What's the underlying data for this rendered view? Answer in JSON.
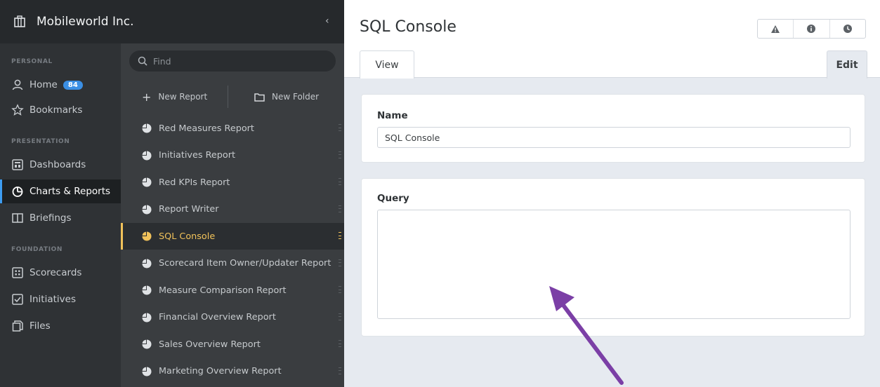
{
  "org": {
    "name": "Mobileworld Inc.",
    "collapse_glyph": "‹"
  },
  "nav": {
    "sections": [
      {
        "id": "personal",
        "label": "PERSONAL"
      },
      {
        "id": "presentation",
        "label": "PRESENTATION"
      },
      {
        "id": "foundation",
        "label": "FOUNDATION"
      }
    ],
    "items": [
      {
        "label": "Home",
        "icon": "user-icon",
        "badge": "84"
      },
      {
        "label": "Bookmarks",
        "icon": "star-icon"
      },
      {
        "label": "Dashboards",
        "icon": "dashboard-icon"
      },
      {
        "label": "Charts & Reports",
        "icon": "pie-chart-icon",
        "active": true
      },
      {
        "label": "Briefings",
        "icon": "book-icon"
      },
      {
        "label": "Scorecards",
        "icon": "scorecard-icon"
      },
      {
        "label": "Initiatives",
        "icon": "checkbox-icon"
      },
      {
        "label": "Files",
        "icon": "files-icon"
      }
    ]
  },
  "list": {
    "search_placeholder": "Find",
    "new_report_label": "New Report",
    "new_folder_label": "New Folder",
    "reports": [
      {
        "label": "Red Measures Report"
      },
      {
        "label": "Initiatives Report"
      },
      {
        "label": "Red KPIs Report"
      },
      {
        "label": "Report Writer"
      },
      {
        "label": "SQL Console",
        "selected": true
      },
      {
        "label": "Scorecard Item Owner/Updater Report"
      },
      {
        "label": "Measure Comparison Report"
      },
      {
        "label": "Financial Overview Report"
      },
      {
        "label": "Sales Overview Report"
      },
      {
        "label": "Marketing Overview Report"
      }
    ]
  },
  "main": {
    "title": "SQL Console",
    "top_icons": [
      "warning-icon",
      "info-icon",
      "clock-icon"
    ],
    "tabs": {
      "view": "View",
      "edit": "Edit"
    },
    "name_label": "Name",
    "name_value": "SQL Console",
    "query_label": "Query",
    "query_value": ""
  },
  "colors": {
    "nav_bg": "#2f3235",
    "list_bg": "#3a3d40",
    "accent_blue": "#3d9cf0",
    "selected_yellow": "#f1c25a",
    "arrow_purple": "#7b3fa6",
    "main_bg": "#e6eaf0"
  }
}
